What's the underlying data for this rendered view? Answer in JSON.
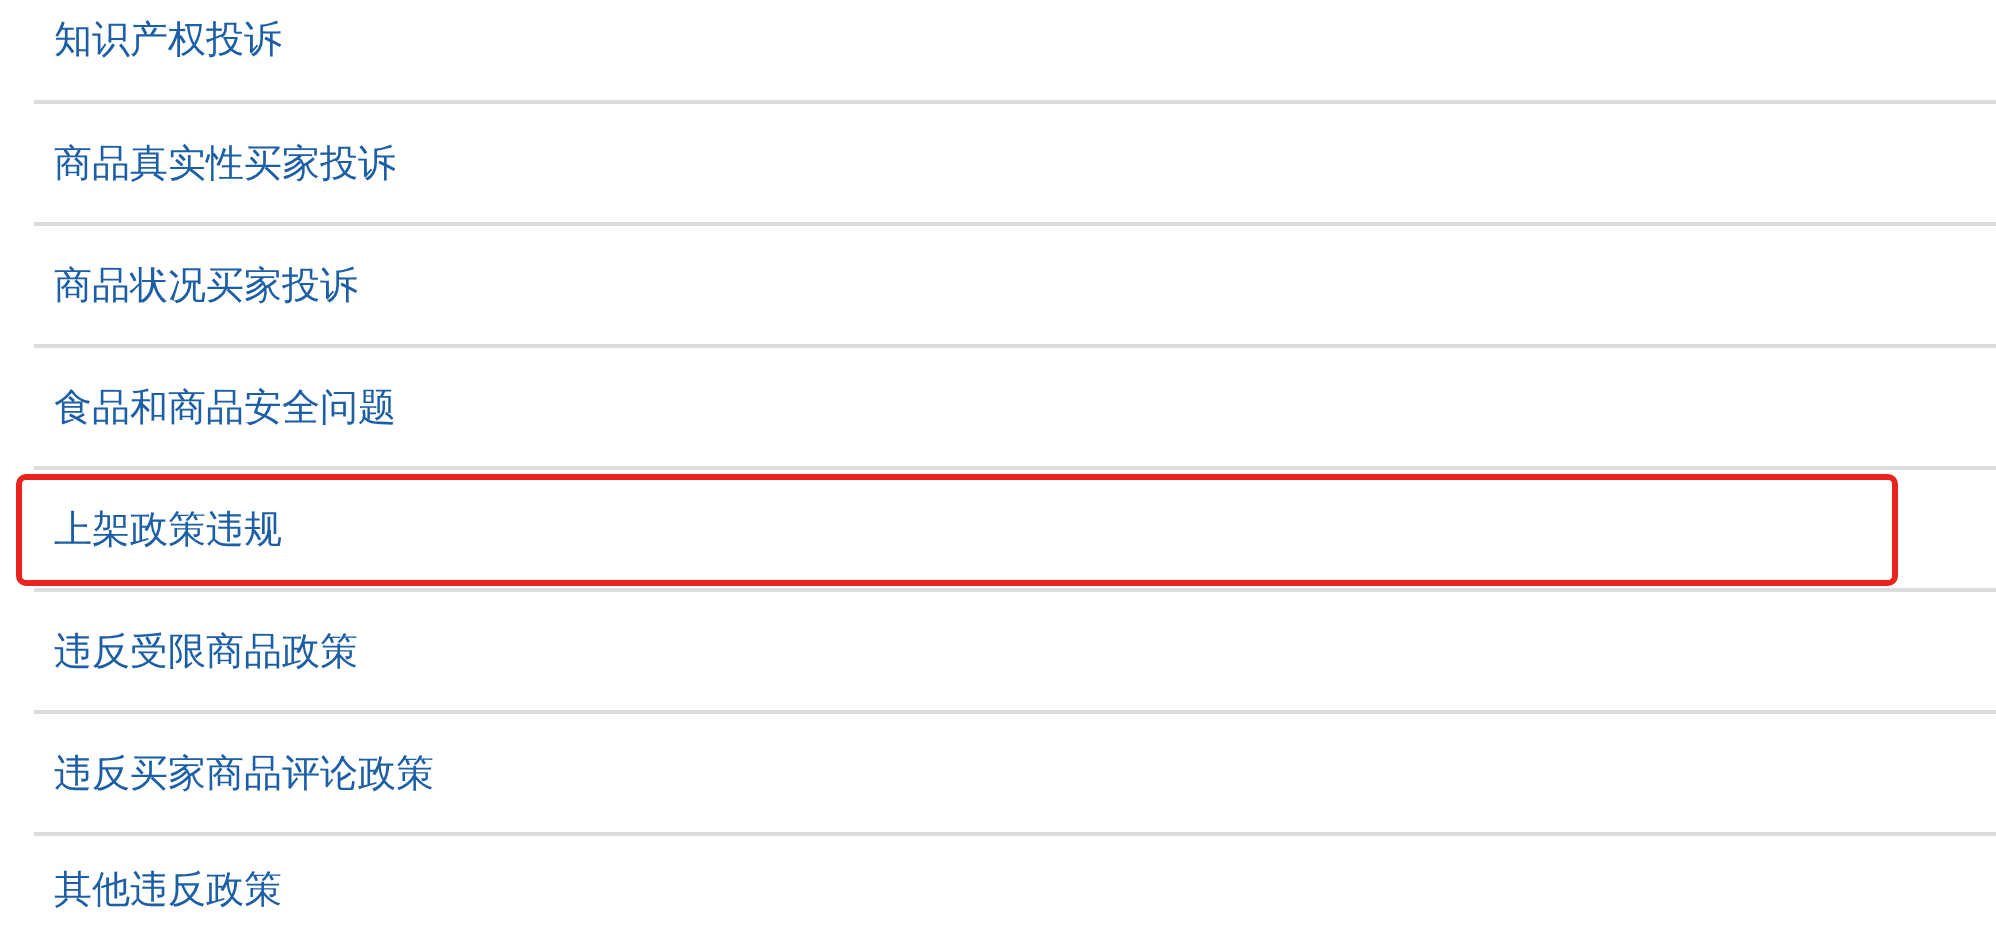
{
  "items": [
    {
      "label": "知识产权投诉",
      "highlighted": false
    },
    {
      "label": "商品真实性买家投诉",
      "highlighted": false
    },
    {
      "label": "商品状况买家投诉",
      "highlighted": false
    },
    {
      "label": "食品和商品安全问题",
      "highlighted": false
    },
    {
      "label": "上架政策违规",
      "highlighted": true
    },
    {
      "label": "违反受限商品政策",
      "highlighted": false
    },
    {
      "label": "违反买家商品评论政策",
      "highlighted": false
    },
    {
      "label": "其他违反政策",
      "highlighted": false
    }
  ]
}
